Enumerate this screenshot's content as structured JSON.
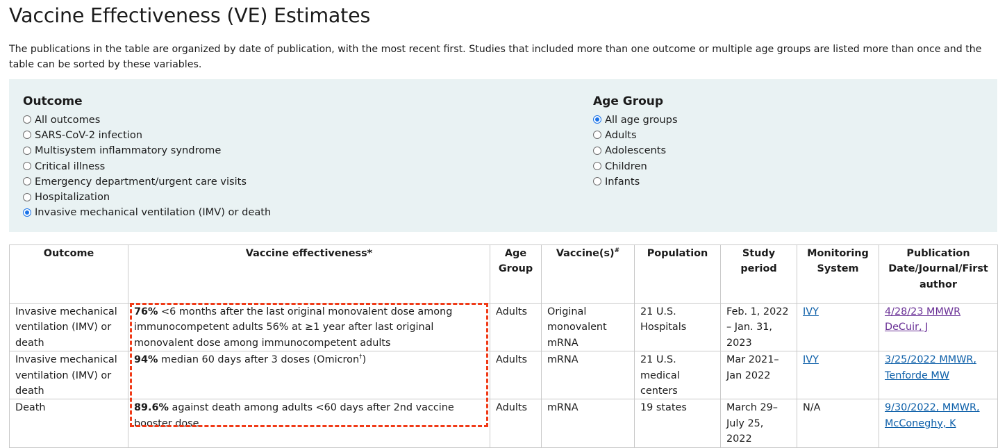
{
  "page": {
    "title": "Vaccine Effectiveness (VE) Estimates",
    "intro": "The publications in the table are organized by date of publication, with the most recent first. Studies that included more than one outcome or multiple age groups are listed more than once and the table can be sorted by these variables."
  },
  "filters": {
    "outcome": {
      "heading": "Outcome",
      "options": [
        {
          "label": "All outcomes",
          "checked": false
        },
        {
          "label": "SARS-CoV-2 infection",
          "checked": false
        },
        {
          "label": "Multisystem inflammatory syndrome",
          "checked": false
        },
        {
          "label": "Critical illness",
          "checked": false
        },
        {
          "label": "Emergency department/urgent care visits",
          "checked": false
        },
        {
          "label": "Hospitalization",
          "checked": false
        },
        {
          "label": "Invasive mechanical ventilation (IMV) or death",
          "checked": true
        }
      ]
    },
    "age": {
      "heading": "Age Group",
      "options": [
        {
          "label": "All age groups",
          "checked": true
        },
        {
          "label": "Adults",
          "checked": false
        },
        {
          "label": "Adolescents",
          "checked": false
        },
        {
          "label": "Children",
          "checked": false
        },
        {
          "label": "Infants",
          "checked": false
        }
      ]
    }
  },
  "table": {
    "headers": {
      "outcome": "Outcome",
      "ve": "Vaccine effectiveness*",
      "age": "Age Group",
      "vaccine": "Vaccine(s)",
      "vaccine_sup": "#",
      "population": "Population",
      "period": "Study period",
      "system": "Monitoring System",
      "publication": "Publication Date/Journal/First author"
    },
    "rows": [
      {
        "outcome": "Invasive mechanical ventilation (IMV) or death",
        "ve_bold": "76%",
        "ve_text": " <6 months after the last original monovalent dose among immunocompetent adults 56% at ≥1 year after last original monovalent dose among immunocompetent adults",
        "age": "Adults",
        "vaccine": "Original monovalent mRNA",
        "population": "21 U.S. Hospitals",
        "period": "Feb. 1, 2022 – Jan. 31, 2023",
        "system": "IVY",
        "publication": "4/28/23 MMWR DeCuir, J"
      },
      {
        "outcome": "Invasive mechanical ventilation (IMV) or death",
        "ve_bold": "94%",
        "ve_text": " median 60 days after 3 doses (Omicron",
        "ve_sup": "†",
        "ve_after": ")",
        "age": "Adults",
        "vaccine": "mRNA",
        "population": "21 U.S. medical centers",
        "period": "Mar 2021– Jan 2022",
        "system": "IVY",
        "publication": "3/25/2022 MMWR, Tenforde MW"
      },
      {
        "outcome": "Death",
        "ve_bold": "89.6%",
        "ve_text": " against death among adults <60 days after 2nd vaccine booster dose",
        "age": "Adults",
        "vaccine": "mRNA",
        "population": "19 states",
        "period": "March 29– July 25, 2022",
        "system": "N/A",
        "publication": "9/30/2022, MMWR, McConeghy, K"
      }
    ]
  },
  "colors": {
    "filter_bg": "#e9f2f3",
    "link": "#0b5ea8",
    "visited_link": "#6a3196",
    "highlight": "#f03a17",
    "radio_checked": "#1a73e8"
  }
}
